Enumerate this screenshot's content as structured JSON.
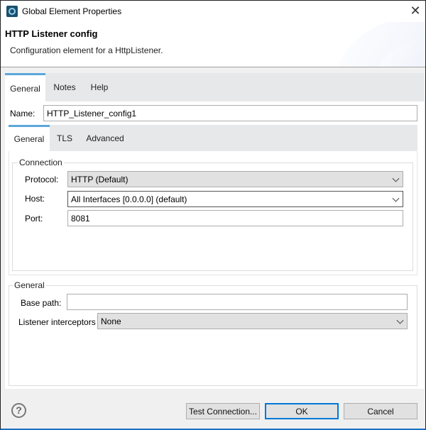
{
  "window": {
    "title": "Global Element Properties",
    "icon": "mule-app-icon",
    "close_icon": "close-icon"
  },
  "header": {
    "title": "HTTP Listener config",
    "description": "Configuration element for a HttpListener."
  },
  "outer_tabs": [
    {
      "label": "General",
      "active": true
    },
    {
      "label": "Notes",
      "active": false
    },
    {
      "label": "Help",
      "active": false
    }
  ],
  "name_field": {
    "label": "Name:",
    "value": "HTTP_Listener_config1"
  },
  "inner_tabs": [
    {
      "label": "General",
      "active": true
    },
    {
      "label": "TLS",
      "active": false
    },
    {
      "label": "Advanced",
      "active": false
    }
  ],
  "connection": {
    "legend": "Connection",
    "protocol": {
      "label": "Protocol:",
      "value": "HTTP (Default)"
    },
    "host": {
      "label": "Host:",
      "value": "All Interfaces [0.0.0.0] (default)"
    },
    "port": {
      "label": "Port:",
      "value": "8081"
    }
  },
  "general": {
    "legend": "General",
    "base_path": {
      "label": "Base path:",
      "value": ""
    },
    "interceptors": {
      "label": "Listener interceptors",
      "value": "None"
    }
  },
  "footer": {
    "help_icon": "question-circle-icon",
    "test_connection": "Test Connection...",
    "ok": "OK",
    "cancel": "Cancel"
  },
  "colors": {
    "accent": "#5ba7db",
    "default_button_border": "#0078d7"
  }
}
